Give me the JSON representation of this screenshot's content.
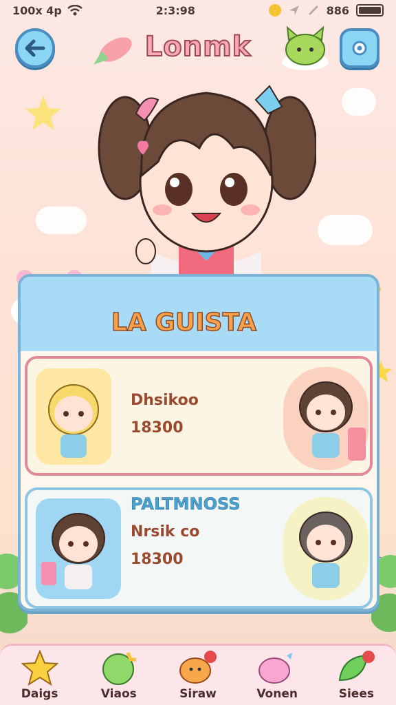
{
  "status": {
    "left_text": "100x 4p",
    "time": "2:3:98",
    "right_text": "886"
  },
  "header": {
    "title": "Lonmk",
    "back_icon": "back-arrow-icon",
    "settings_icon": "settings-icon"
  },
  "panel": {
    "title": "LA GUISTA",
    "cards": [
      {
        "tag": "",
        "name": "Dhsikoo",
        "value": "18300"
      },
      {
        "tag": "PALTMNOSS",
        "name": "Nrsik co",
        "value": "18300"
      }
    ]
  },
  "nav": [
    {
      "label": "Daigs",
      "icon": "star-icon"
    },
    {
      "label": "Viaos",
      "icon": "melon-icon"
    },
    {
      "label": "Siraw",
      "icon": "blob-icon"
    },
    {
      "label": "Vonen",
      "icon": "candy-icon"
    },
    {
      "label": "Siees",
      "icon": "leaf-icon"
    }
  ],
  "colors": {
    "accent_blue": "#8cd6f5",
    "title_pink": "#f9a9b5",
    "panel_head": "#a8dcf6",
    "card_border_pink": "#e18a97"
  }
}
